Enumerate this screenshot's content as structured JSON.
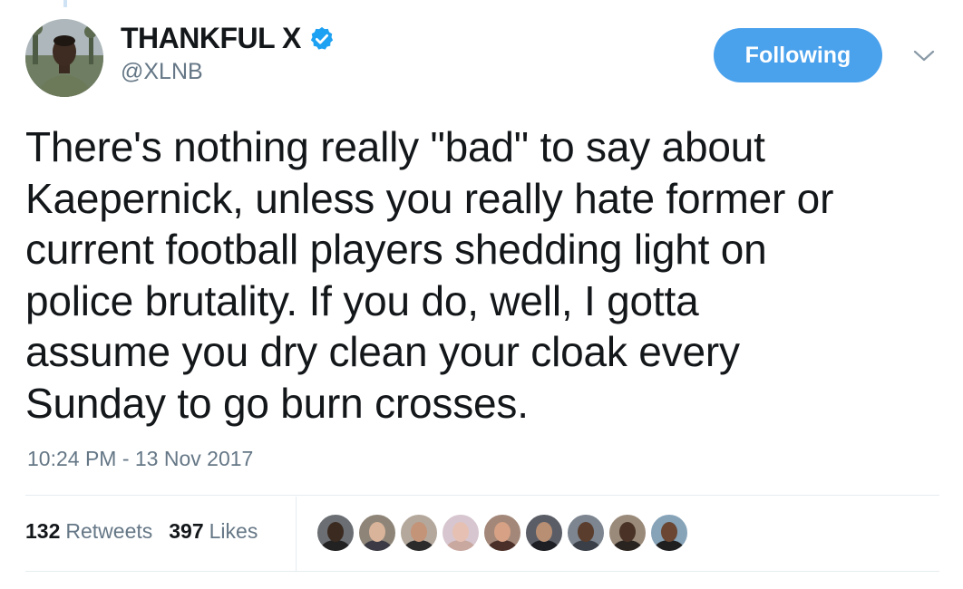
{
  "author": {
    "name": "THANKFUL X",
    "handle": "@XLNB",
    "verified_icon": "verified-badge-icon",
    "avatar_colors": [
      "#b9c3c8",
      "#3b4a35"
    ]
  },
  "follow_button": {
    "label": "Following",
    "color": "#4aa1ec"
  },
  "menu_icon": "chevron-down-icon",
  "tweet": {
    "lines": [
      "There's nothing really \"bad\" to say about",
      "Kaepernick, unless you really hate former or",
      "current football players shedding light on",
      "police brutality. If you do, well, I gotta",
      "assume you dry clean your cloak every",
      "Sunday to go burn crosses."
    ],
    "timestamp": "10:24 PM - 13 Nov 2017"
  },
  "stats": {
    "retweets_count": "132",
    "retweets_label": "Retweets",
    "likes_count": "397",
    "likes_label": "Likes"
  },
  "likers": [
    {
      "bg": "#6b6f73",
      "skin": "#3a2a20",
      "shirt": "#222222"
    },
    {
      "bg": "#8e8578",
      "skin": "#d9b49a",
      "shirt": "#3c3a44"
    },
    {
      "bg": "#b4a89c",
      "skin": "#c49478",
      "shirt": "#2b2b2b"
    },
    {
      "bg": "#d7c6cf",
      "skin": "#e6c1b3",
      "shirt": "#c9a8a0"
    },
    {
      "bg": "#a38779",
      "skin": "#d6a184",
      "shirt": "#4a3028"
    },
    {
      "bg": "#5a5d66",
      "skin": "#b98f73",
      "shirt": "#1d1f24"
    },
    {
      "bg": "#7c8590",
      "skin": "#5a3d2c",
      "shirt": "#3a3f48"
    },
    {
      "bg": "#9a8a7a",
      "skin": "#4a3326",
      "shirt": "#2a2420"
    },
    {
      "bg": "#86a3b8",
      "skin": "#6b4632",
      "shirt": "#1f1f1f"
    }
  ]
}
